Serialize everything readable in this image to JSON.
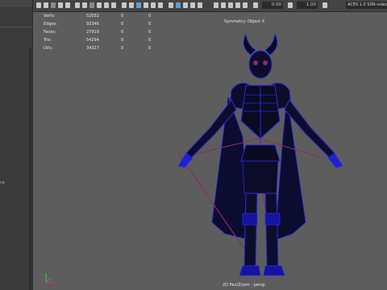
{
  "left_panel": {
    "fragment": "ce"
  },
  "toolbar": {
    "value1": "0.00",
    "value2": "1.00",
    "color_management": "ACES 1.0 SDR-video"
  },
  "hud": {
    "rows": [
      {
        "label": "Verts:",
        "v1": "52032",
        "v2": "0",
        "v3": "0"
      },
      {
        "label": "Edges:",
        "v1": "93346",
        "v2": "0",
        "v3": "0"
      },
      {
        "label": "Faces:",
        "v1": "27919",
        "v2": "0",
        "v3": "0"
      },
      {
        "label": "Tris:",
        "v1": "54294",
        "v2": "0",
        "v3": "0"
      },
      {
        "label": "UVs:",
        "v1": "34327",
        "v2": "0",
        "v3": "0"
      }
    ]
  },
  "viewport": {
    "symmetry": "Symmetry: Object X",
    "camera": "2D Pan/Zoom : persp"
  },
  "colors": {
    "viewport_bg": "#5d5d5d",
    "wireframe": "#1f1fd6",
    "joint": "#8a2d6a"
  }
}
